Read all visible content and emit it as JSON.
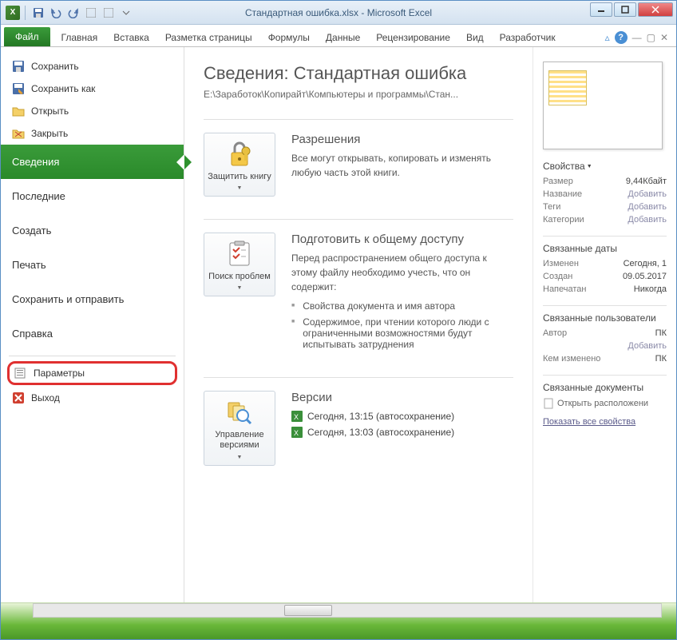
{
  "titlebar": {
    "title": "Стандартная ошибка.xlsx - Microsoft Excel"
  },
  "tabs": {
    "file": "Файл",
    "items": [
      "Главная",
      "Вставка",
      "Разметка страницы",
      "Формулы",
      "Данные",
      "Рецензирование",
      "Вид",
      "Разработчик"
    ]
  },
  "nav": {
    "save": "Сохранить",
    "save_as": "Сохранить как",
    "open": "Открыть",
    "close": "Закрыть",
    "info": "Сведения",
    "recent": "Последние",
    "new": "Создать",
    "print": "Печать",
    "share": "Сохранить и отправить",
    "help": "Справка",
    "options": "Параметры",
    "exit": "Выход"
  },
  "info": {
    "title": "Сведения: Стандартная ошибка",
    "path": "E:\\Заработок\\Копирайт\\Компьютеры и программы\\Стан...",
    "protect": {
      "btn": "Защитить книгу",
      "head": "Разрешения",
      "text": "Все могут открывать, копировать и изменять любую часть этой книги."
    },
    "inspect": {
      "btn": "Поиск проблем",
      "head": "Подготовить к общему доступу",
      "text": "Перед распространением общего доступа к этому файлу необходимо учесть, что он содержит:",
      "bullets": [
        "Свойства документа и имя автора",
        "Содержимое, при чтении которого люди с ограниченными возможностями будут испытывать затруднения"
      ]
    },
    "versions": {
      "btn": "Управление версиями",
      "head": "Версии",
      "items": [
        "Сегодня, 13:15 (автосохранение)",
        "Сегодня, 13:03 (автосохранение)"
      ]
    }
  },
  "props": {
    "header": "Свойства",
    "rows": [
      {
        "k": "Размер",
        "v": "9,44Кбайт"
      },
      {
        "k": "Название",
        "v": "Добавить",
        "link": true
      },
      {
        "k": "Теги",
        "v": "Добавить",
        "link": true
      },
      {
        "k": "Категории",
        "v": "Добавить",
        "link": true
      }
    ],
    "dates_header": "Связанные даты",
    "dates": [
      {
        "k": "Изменен",
        "v": "Сегодня, 1"
      },
      {
        "k": "Создан",
        "v": "09.05.2017"
      },
      {
        "k": "Напечатан",
        "v": "Никогда"
      }
    ],
    "users_header": "Связанные пользователи",
    "users": [
      {
        "k": "Автор",
        "v": "ПК"
      },
      {
        "k": "",
        "v": "Добавить",
        "link": true
      },
      {
        "k": "Кем изменено",
        "v": "ПК"
      }
    ],
    "docs_header": "Связанные документы",
    "open_location": "Открыть расположени",
    "show_all": "Показать все свойства"
  }
}
